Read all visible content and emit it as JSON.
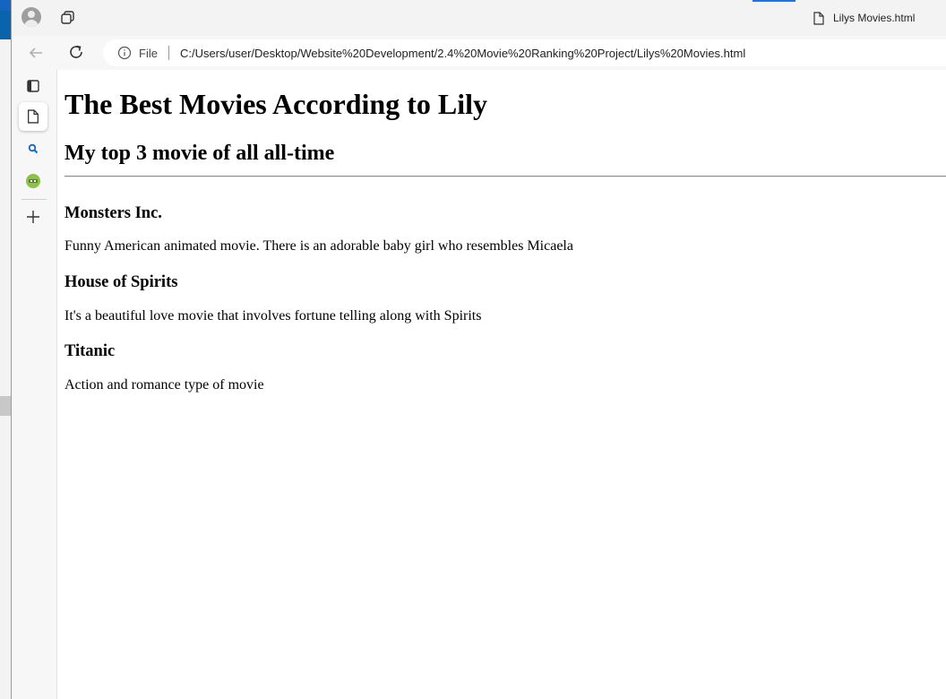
{
  "browser": {
    "tab_title": "Lilys Movies.html",
    "address": {
      "scheme_label": "File",
      "url": "C:/Users/user/Desktop/Website%20Development/2.4%20Movie%20Ranking%20Project/Lilys%20Movies.html"
    }
  },
  "page": {
    "title": "The Best Movies According to Lily",
    "subtitle": "My top 3 movie of all all-time",
    "movies": [
      {
        "name": "Monsters Inc.",
        "description": "Funny American animated movie. There is an adorable baby girl who resembles Micaela"
      },
      {
        "name": "House of Spirits",
        "description": "It's a beautiful love movie that involves fortune telling along with Spirits"
      },
      {
        "name": "Titanic",
        "description": "Action and romance type of movie"
      }
    ]
  },
  "colors": {
    "accent": "#1a73e8",
    "sidebar_search": "#1565c0",
    "extension_green": "#8bc34a"
  }
}
